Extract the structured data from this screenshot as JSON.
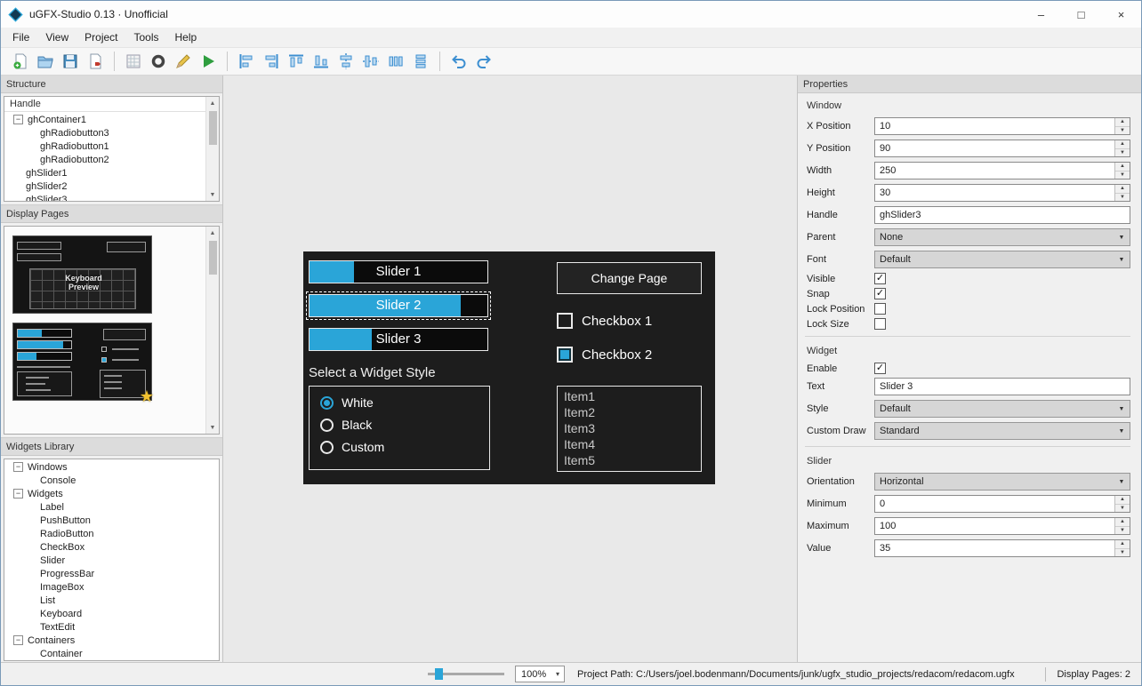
{
  "titlebar": {
    "title": "uGFX-Studio 0.13   ·   Unofficial",
    "controls": {
      "minimize": "–",
      "maximize": "□",
      "close": "×"
    }
  },
  "menubar": {
    "items": [
      "File",
      "View",
      "Project",
      "Tools",
      "Help"
    ]
  },
  "toolbar": {
    "file_icons": [
      "new-icon",
      "open-icon",
      "save-icon",
      "save-as-icon"
    ],
    "project_icons": [
      "generate-icon",
      "target-icon",
      "edit-icon",
      "run-icon"
    ],
    "align_icons": [
      "align-left-icon",
      "align-right-icon",
      "align-top-icon",
      "align-bottom-icon",
      "center-horizontal-icon",
      "center-vertical-icon",
      "distribute-horizontal-icon",
      "distribute-vertical-icon"
    ],
    "history_icons": [
      "undo-icon",
      "redo-icon"
    ]
  },
  "structure": {
    "title": "Structure",
    "column_header": "Handle",
    "items": [
      {
        "label": "ghContainer1",
        "level": 0,
        "expand": true
      },
      {
        "label": "ghRadiobutton3",
        "level": 1
      },
      {
        "label": "ghRadiobutton1",
        "level": 1
      },
      {
        "label": "ghRadiobutton2",
        "level": 1
      },
      {
        "label": "ghSlider1",
        "level": 0
      },
      {
        "label": "ghSlider2",
        "level": 0
      },
      {
        "label": "ghSlider3",
        "level": 0
      }
    ]
  },
  "display_pages": {
    "title": "Display Pages",
    "pages": [
      {
        "caption": "Keyboard Preview"
      },
      {
        "caption": "",
        "starred": true
      }
    ]
  },
  "widgets_library": {
    "title": "Widgets Library",
    "groups": [
      {
        "label": "Windows",
        "children": [
          "Console"
        ]
      },
      {
        "label": "Widgets",
        "children": [
          "Label",
          "PushButton",
          "RadioButton",
          "CheckBox",
          "Slider",
          "ProgressBar",
          "ImageBox",
          "List",
          "Keyboard",
          "TextEdit"
        ]
      },
      {
        "label": "Containers",
        "children": [
          "Container"
        ]
      }
    ]
  },
  "canvas": {
    "accent_color": "#2aa5d8",
    "sliders": [
      {
        "label": "Slider 1",
        "value_pct": 25,
        "selected": false
      },
      {
        "label": "Slider 2",
        "value_pct": 85,
        "selected": true
      },
      {
        "label": "Slider 3",
        "value_pct": 35,
        "selected": false
      }
    ],
    "style_heading": "Select a Widget Style",
    "radio_options": [
      {
        "label": "White",
        "selected": true
      },
      {
        "label": "Black",
        "selected": false
      },
      {
        "label": "Custom",
        "selected": false
      }
    ],
    "button_label": "Change Page",
    "checkboxes": [
      {
        "label": "Checkbox 1",
        "checked": false
      },
      {
        "label": "Checkbox 2",
        "checked": true
      }
    ],
    "list_items": [
      "Item1",
      "Item2",
      "Item3",
      "Item4",
      "Item5"
    ]
  },
  "properties": {
    "title": "Properties",
    "groups": [
      {
        "name": "Window",
        "rows": [
          {
            "label": "X Position",
            "type": "spin",
            "value": "10"
          },
          {
            "label": "Y Position",
            "type": "spin",
            "value": "90"
          },
          {
            "label": "Width",
            "type": "spin",
            "value": "250"
          },
          {
            "label": "Height",
            "type": "spin",
            "value": "30"
          },
          {
            "label": "Handle",
            "type": "text",
            "value": "ghSlider3"
          },
          {
            "label": "Parent",
            "type": "select",
            "value": "None"
          },
          {
            "label": "Font",
            "type": "select",
            "value": "Default"
          },
          {
            "label": "Visible",
            "type": "check",
            "checked": true
          },
          {
            "label": "Snap",
            "type": "check",
            "checked": true
          },
          {
            "label": "Lock Position",
            "type": "check",
            "checked": false
          },
          {
            "label": "Lock Size",
            "type": "check",
            "checked": false
          }
        ]
      },
      {
        "name": "Widget",
        "rows": [
          {
            "label": "Enable",
            "type": "check",
            "checked": true
          },
          {
            "label": "Text",
            "type": "text",
            "value": "Slider 3"
          },
          {
            "label": "Style",
            "type": "select",
            "value": "Default"
          },
          {
            "label": "Custom Draw",
            "type": "select",
            "value": "Standard"
          }
        ]
      },
      {
        "name": "Slider",
        "rows": [
          {
            "label": "Orientation",
            "type": "select",
            "value": "Horizontal"
          },
          {
            "label": "Minimum",
            "type": "spin",
            "value": "0"
          },
          {
            "label": "Maximum",
            "type": "spin",
            "value": "100"
          },
          {
            "label": "Value",
            "type": "spin",
            "value": "35"
          }
        ]
      }
    ]
  },
  "statusbar": {
    "zoom_value": "100%",
    "project_path": "Project Path: C:/Users/joel.bodenmann/Documents/junk/ugfx_studio_projects/redacom/redacom.ugfx",
    "pages_status": "Display Pages: 2"
  }
}
